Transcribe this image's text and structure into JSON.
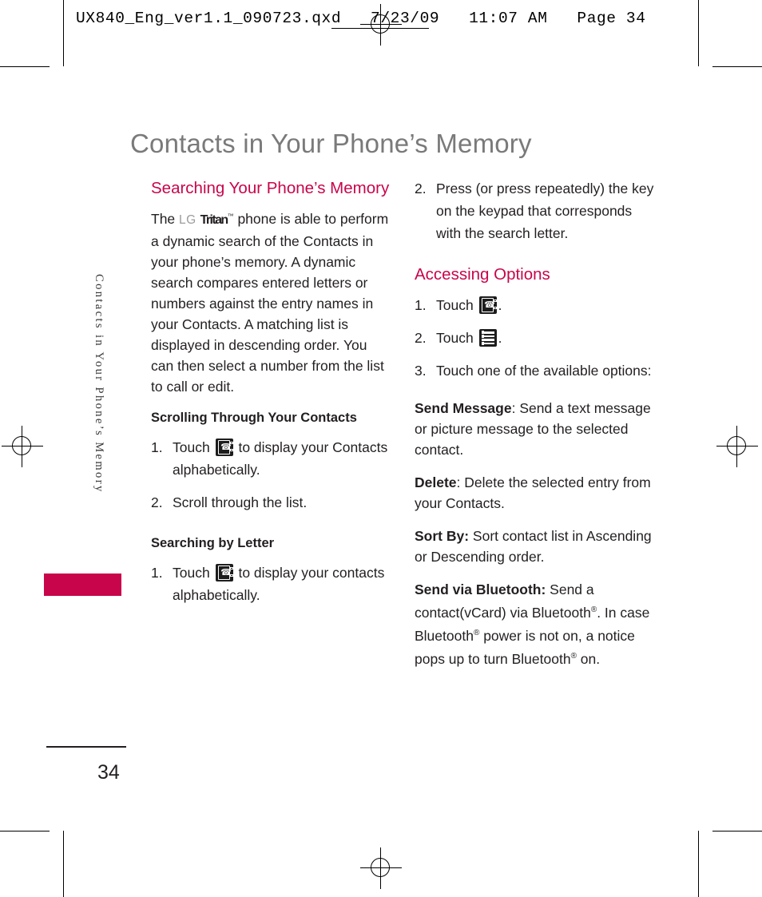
{
  "print_header": {
    "text": "UX840_Eng_ver1.1_090723.qxd   7/23/09   11:07 AM   Page 34"
  },
  "side_tab": {
    "label": "Contacts in Your Phone’s Memory"
  },
  "page_title": "Contacts in Your Phone’s Memory",
  "colors": {
    "accent": "#c8054b",
    "title_gray": "#7a7a7a",
    "body": "#231f20"
  },
  "left_column": {
    "section_heading": "Searching Your Phone’s Memory",
    "intro_before_logo": "The",
    "logo_lg": "LG",
    "logo_tritan": "Tritan",
    "logo_tm": "™",
    "intro_after_logo": "phone is able to perform a dynamic search of the Contacts in your phone’s memory. A dynamic search compares entered letters or numbers against the entry names in your Contacts. A matching list is displayed in descending order. You can then select a number from the list to call or edit.",
    "subsection_scrolling": "Scrolling Through Your Contacts",
    "scrolling_steps": [
      {
        "num": "1.",
        "text_before_icon": "Touch",
        "icon": "contacts-icon",
        "text_after_icon": "to display your Contacts alphabetically."
      },
      {
        "num": "2.",
        "text_before_icon": "Scroll through the list.",
        "icon": "",
        "text_after_icon": ""
      }
    ],
    "subsection_searching": "Searching by Letter",
    "searching_steps": [
      {
        "num": "1.",
        "text_before_icon": "Touch",
        "icon": "contacts-icon",
        "text_after_icon": "to display your contacts alphabetically."
      }
    ]
  },
  "right_column": {
    "continued_step": {
      "num": "2.",
      "text": "Press (or press repeatedly) the key on the keypad that corresponds with the search letter."
    },
    "section_heading": "Accessing Options",
    "option_steps": [
      {
        "num": "1.",
        "text_before_icon": "Touch",
        "icon": "contacts-icon",
        "text_after_icon": "."
      },
      {
        "num": "2.",
        "text_before_icon": "Touch",
        "icon": "menu-icon",
        "text_after_icon": "."
      },
      {
        "num": "3.",
        "text_before_icon": "Touch one of the available options:",
        "icon": "",
        "text_after_icon": ""
      }
    ],
    "options": [
      {
        "term": "Send Message",
        "separator": ":",
        "description": " Send a text message or picture message to the selected contact."
      },
      {
        "term": "Delete",
        "separator": ":",
        "description": " Delete the selected entry from your Contacts."
      },
      {
        "term": "Sort By:",
        "separator": "",
        "description": "  Sort contact list in Ascending or Descending order."
      }
    ],
    "bluetooth_option": {
      "term": "Send via Bluetooth:",
      "part1": " Send a contact(vCard) via Bluetooth",
      "reg1": "®",
      "part2": ". In case Bluetooth",
      "reg2": "®",
      "part3": " power is not on, a notice pops up to turn Bluetooth",
      "reg3": "®",
      "part4": " on."
    }
  },
  "footer": {
    "page_number": "34"
  }
}
